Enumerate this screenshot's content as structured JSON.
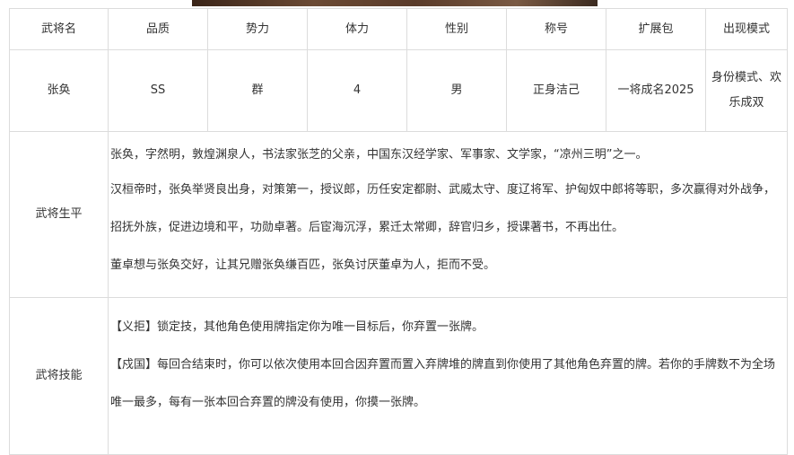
{
  "headers": [
    "武将名",
    "品质",
    "势力",
    "体力",
    "性别",
    "称号",
    "扩展包",
    "出现模式"
  ],
  "general": {
    "name": "张奂",
    "quality": "SS",
    "faction": "群",
    "hp": "4",
    "gender": "男",
    "title": "正身洁己",
    "pack": "一将成名2025",
    "mode": "身份模式、欢乐成双"
  },
  "bio": {
    "label": "武将生平",
    "paragraphs": [
      "张奂，字然明，敦煌渊泉人，书法家张芝的父亲，中国东汉经学家、军事家、文学家，“凉州三明”之一。",
      "汉桓帝时，张奂举贤良出身，对策第一，授议郎，历任安定都尉、武威太守、度辽将军、护匈奴中郎将等职，多次赢得对外战争，招抚外族，促进边境和平，功勋卓著。后宦海沉浮，累迁太常卿，辞官归乡，授课著书，不再出仕。",
      "董卓想与张奂交好，让其兄赠张奂缣百匹，张奂讨厌董卓为人，拒而不受。"
    ]
  },
  "skills": {
    "label": "武将技能",
    "items": [
      {
        "name": "【义拒】",
        "text": "锁定技，其他角色使用牌指定你为唯一目标后，你弃置一张牌。"
      },
      {
        "name": "【戍国】",
        "text": "每回合结束时，你可以依次使用本回合因弃置而置入弃牌堆的牌直到你使用了其他角色弃置的牌。若你的手牌数不为全场唯一最多，每有一张本回合弃置的牌没有使用，你摸一张牌。"
      }
    ]
  }
}
